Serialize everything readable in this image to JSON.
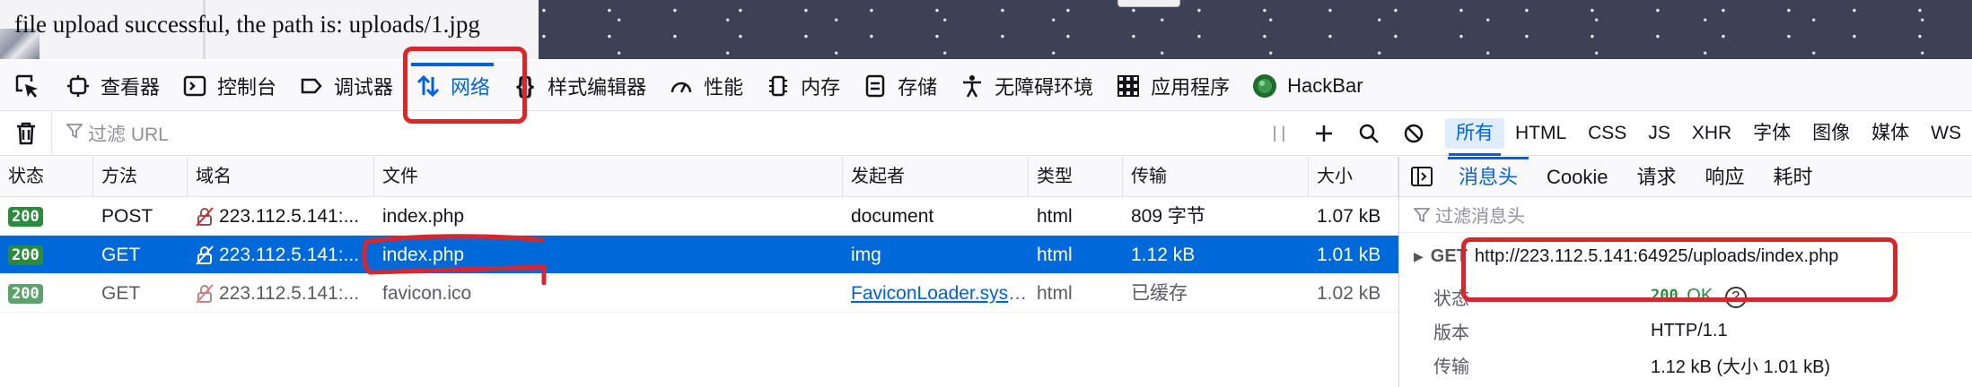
{
  "page": {
    "message": "file upload successful, the path is: uploads/1.jpg"
  },
  "toolbar": {
    "tabs": [
      {
        "label": "查看器",
        "icon": "inspector-icon"
      },
      {
        "label": "控制台",
        "icon": "console-icon"
      },
      {
        "label": "调试器",
        "icon": "debugger-icon"
      },
      {
        "label": "网络",
        "icon": "network-icon",
        "selected": true
      },
      {
        "label": "样式编辑器",
        "icon": "style-editor-icon"
      },
      {
        "label": "性能",
        "icon": "performance-icon"
      },
      {
        "label": "内存",
        "icon": "memory-icon"
      },
      {
        "label": "存储",
        "icon": "storage-icon"
      },
      {
        "label": "无障碍环境",
        "icon": "accessibility-icon"
      },
      {
        "label": "应用程序",
        "icon": "application-icon"
      },
      {
        "label": "HackBar",
        "icon": "hackbar-icon"
      }
    ]
  },
  "filterbar": {
    "url_placeholder": "过滤 URL",
    "pause_glyph": "| |",
    "types": [
      "所有",
      "HTML",
      "CSS",
      "JS",
      "XHR",
      "字体",
      "图像",
      "媒体",
      "WS"
    ],
    "active_type": "所有"
  },
  "table": {
    "columns": [
      "状态",
      "方法",
      "域名",
      "文件",
      "发起者",
      "类型",
      "传输",
      "大小"
    ],
    "rows": [
      {
        "status": "200",
        "method": "POST",
        "domain": "223.112.5.141:...",
        "file": "index.php",
        "initiator": "document",
        "type": "html",
        "transfer": "809 字节",
        "size": "1.07 kB"
      },
      {
        "status": "200",
        "method": "GET",
        "domain": "223.112.5.141:...",
        "file": "index.php",
        "initiator": "img",
        "type": "html",
        "transfer": "1.12 kB",
        "size": "1.01 kB",
        "selected": true
      },
      {
        "status": "200",
        "method": "GET",
        "domain": "223.112.5.141:...",
        "file": "favicon.ico",
        "initiator": "FaviconLoader.sys....",
        "type": "html",
        "transfer": "已缓存",
        "size": "1.02 kB",
        "cached": true
      }
    ]
  },
  "side": {
    "tabs": [
      "消息头",
      "Cookie",
      "请求",
      "响应",
      "耗时"
    ],
    "active_tab": "消息头",
    "filter_placeholder": "过滤消息头",
    "summary_method": "GET",
    "summary_url": "http://223.112.5.141:64925/uploads/index.php",
    "details": [
      {
        "key": "状态",
        "value": "200",
        "extra": "OK"
      },
      {
        "key": "版本",
        "value": "HTTP/1.1"
      },
      {
        "key": "传输",
        "value": "1.12 kB (大小 1.01 kB)"
      }
    ]
  },
  "colors": {
    "accent": "#0061e0",
    "selected_row": "#0069d9",
    "status_ok": "#2b8a3e",
    "annotation": "#d9262b"
  }
}
